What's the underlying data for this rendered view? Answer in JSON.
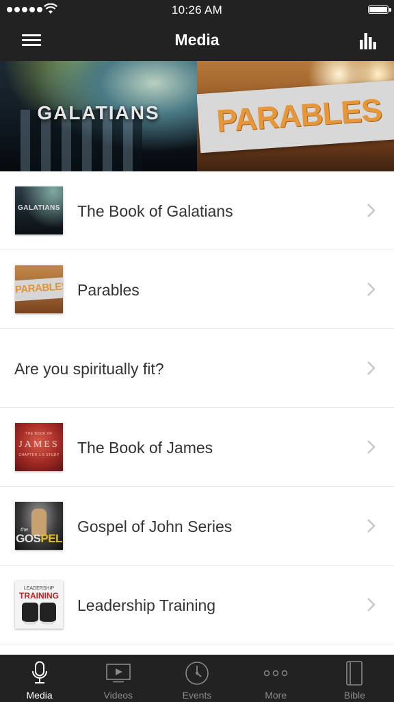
{
  "status_bar": {
    "time": "10:26 AM"
  },
  "nav_bar": {
    "title": "Media"
  },
  "banner": [
    {
      "title": "GALATIANS"
    },
    {
      "title": "PARABLES"
    }
  ],
  "list": {
    "items": [
      {
        "label": "The Book of Galatians",
        "thumb_text": "GALATIANS"
      },
      {
        "label": "Parables",
        "thumb_text": "PARABLES"
      },
      {
        "label": "Are you spiritually fit?"
      },
      {
        "label": "The Book of James",
        "thumb_text": "JAMES",
        "thumb_title_top": "THE BOOK OF",
        "thumb_subtitle": "CHAPTER 1-5 STUDY"
      },
      {
        "label": "Gospel of John Series",
        "thumb_text_1": "GOS",
        "thumb_text_2": "PEL",
        "thumb_title_top": "the"
      },
      {
        "label": "Leadership Training",
        "thumb_text_top": "LEADERSHIP",
        "thumb_text": "TRAINING"
      }
    ]
  },
  "tab_bar": {
    "tabs": [
      {
        "label": "Media",
        "icon": "microphone-icon",
        "active": true
      },
      {
        "label": "Videos",
        "icon": "video-play-icon",
        "active": false
      },
      {
        "label": "Events",
        "icon": "clock-icon",
        "active": false
      },
      {
        "label": "More",
        "icon": "more-dots-icon",
        "active": false
      },
      {
        "label": "Bible",
        "icon": "book-icon",
        "active": false
      }
    ]
  },
  "colors": {
    "bar_background": "#222222",
    "active_tab": "#ffffff",
    "inactive_tab": "#8a8a8a",
    "row_text": "#333333",
    "chevron": "#c7c7cc"
  }
}
